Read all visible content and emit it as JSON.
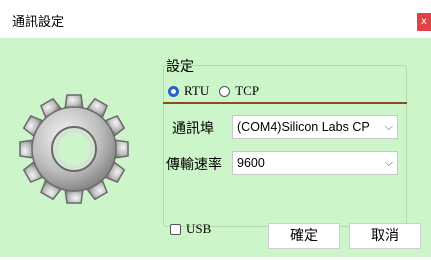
{
  "window": {
    "title": "通訊設定",
    "close_glyph": "x"
  },
  "gear_icon": "gear-icon",
  "group": {
    "title": "設定",
    "radios": [
      {
        "label": "RTU",
        "checked": true
      },
      {
        "label": "TCP",
        "checked": false
      }
    ],
    "port_label": "通訊埠",
    "port_value": "(COM4)Silicon Labs CP",
    "baud_label": "傳輸速率",
    "baud_value": "9600",
    "usb_label": "USB",
    "usb_checked": false
  },
  "buttons": {
    "ok": "確定",
    "cancel": "取消"
  },
  "colors": {
    "background": "#ccf5c9",
    "radio_accent": "#2563c9",
    "divider": "#8b4a1f",
    "close_button": "#e04343"
  }
}
